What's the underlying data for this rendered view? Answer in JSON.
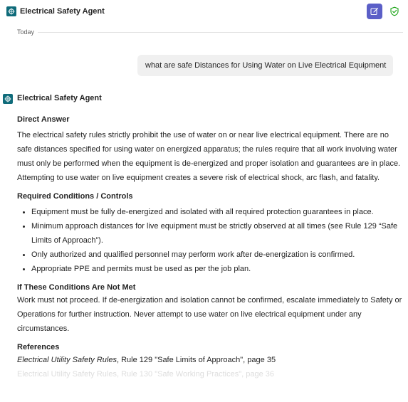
{
  "header": {
    "app_title": "Electrical Safety Agent",
    "icons": {
      "logo": "agent-logo-icon",
      "new_chat": "compose-icon",
      "shield": "shield-check-icon"
    },
    "colors": {
      "brand": "#0f6b7a",
      "accent": "#5b5fc7",
      "shield": "#13a10e"
    }
  },
  "divider": {
    "label": "Today"
  },
  "user_message": {
    "text": "what are safe Distances for Using Water on Live Electrical Equipment"
  },
  "agent": {
    "name": "Electrical Safety Agent",
    "sections": {
      "direct_answer": {
        "title": "Direct Answer",
        "body": "The electrical safety rules strictly prohibit the use of water on or near live electrical equipment. There are no safe distances specified for using water on energized apparatus; the rules require that all work involving water must only be performed when the equipment is de-energized and proper isolation and guarantees are in place. Attempting to use water on live equipment creates a severe risk of electrical shock, arc flash, and fatality."
      },
      "required_conditions": {
        "title": "Required Conditions / Controls",
        "items": [
          "Equipment must be fully de-energized and isolated with all required protection guarantees in place.",
          "Minimum approach distances for live equipment must be strictly observed at all times (see Rule 129 “Safe Limits of Approach”).",
          "Only authorized and qualified personnel may perform work after de-energization is confirmed.",
          "Appropriate PPE and permits must be used as per the job plan."
        ]
      },
      "not_met": {
        "title": "If These Conditions Are Not Met",
        "body": "Work must not proceed. If de-energization and isolation cannot be confirmed, escalate immediately to Safety or Operations for further instruction. Never attempt to use water on live electrical equipment under any circumstances."
      },
      "references": {
        "title": "References",
        "doc_title": "Electrical Utility Safety Rules",
        "doc_detail": ", Rule 129 \"Safe Limits of Approach\", page 35",
        "faded_line": "Electrical Utility Safety Rules, Rule 130 \"Safe Working Practices\", page 36"
      }
    }
  }
}
